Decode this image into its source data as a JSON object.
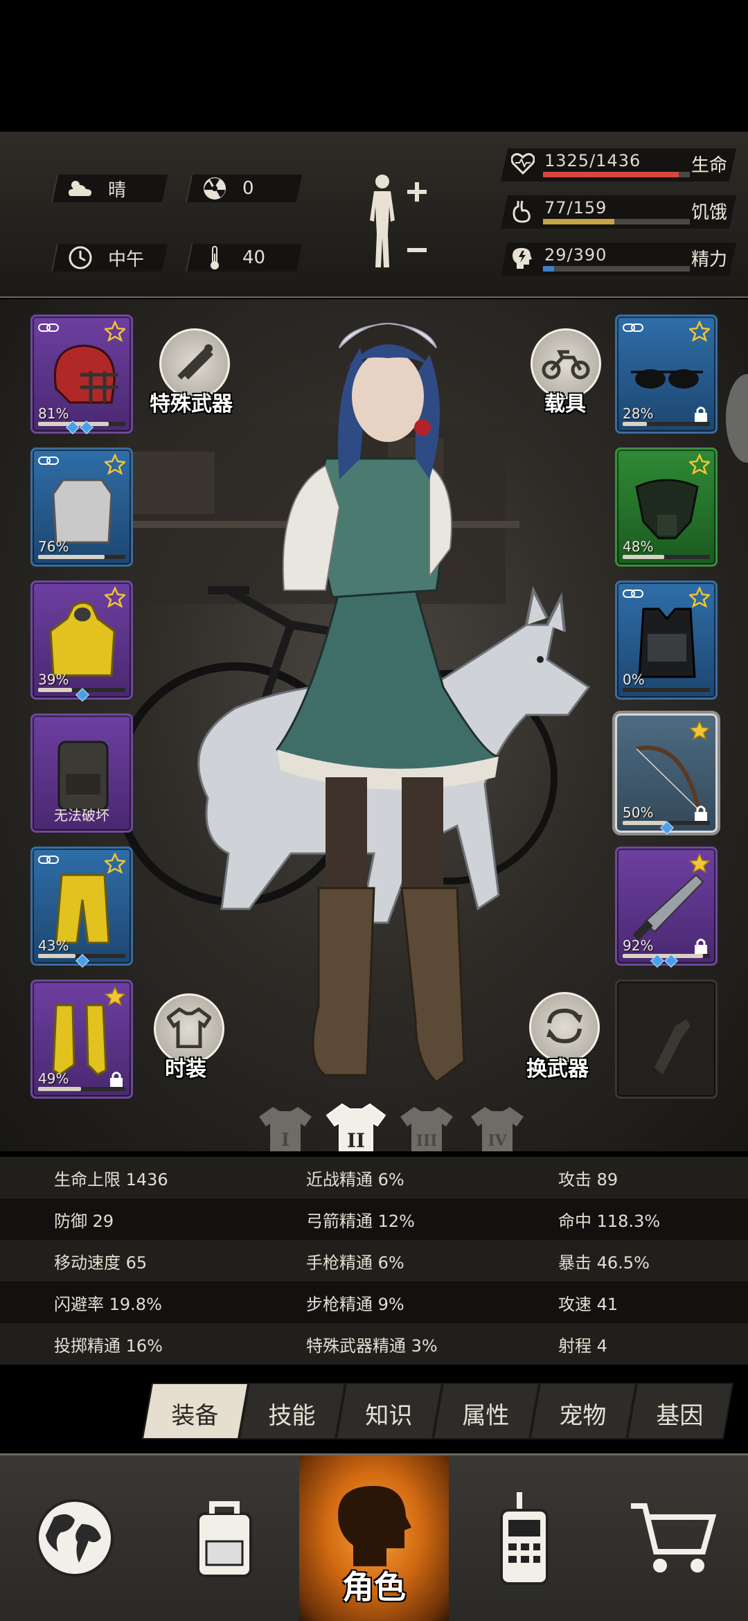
{
  "status": {
    "weather": "晴",
    "radiation": "0",
    "time_of_day": "中午",
    "temperature": "40"
  },
  "vitals": [
    {
      "label": "生命",
      "value": "1325/1436",
      "ratio": 0.923,
      "color": "#d9463f",
      "icon": "heart-icon"
    },
    {
      "label": "饥饿",
      "value": "77/159",
      "ratio": 0.484,
      "color": "#c9a443",
      "icon": "stomach-icon"
    },
    {
      "label": "精力",
      "value": "29/390",
      "ratio": 0.074,
      "color": "#3f7fc9",
      "icon": "energy-head-icon"
    }
  ],
  "left_slots": [
    {
      "name": "helmet",
      "pct": "81%",
      "rarity": "purple",
      "gems": 2
    },
    {
      "name": "shirt",
      "pct": "76%",
      "rarity": "blue",
      "gems": 0
    },
    {
      "name": "raincoat",
      "pct": "39%",
      "rarity": "purple",
      "gems": 1
    },
    {
      "name": "backpack",
      "caption": "无法破坏",
      "rarity": "purple",
      "gems": 0
    },
    {
      "name": "pants",
      "pct": "43%",
      "rarity": "blue",
      "gems": 1
    },
    {
      "name": "boots",
      "pct": "49%",
      "rarity": "purple",
      "gems": 0
    }
  ],
  "right_slots": [
    {
      "name": "sunglasses",
      "pct": "28%",
      "rarity": "blue",
      "gems": 0
    },
    {
      "name": "mask",
      "pct": "48%",
      "rarity": "green",
      "gems": 0
    },
    {
      "name": "vest",
      "pct": "0%",
      "rarity": "blue",
      "gems": 0
    },
    {
      "name": "bow",
      "pct": "50%",
      "rarity": "white",
      "gems": 1
    },
    {
      "name": "machete",
      "pct": "92%",
      "rarity": "purple",
      "gems": 2
    },
    {
      "name": "empty-slot",
      "rarity": "empty",
      "gems": 0
    }
  ],
  "buttons": {
    "special_weapon": "特殊武器",
    "vehicle": "载具",
    "fashion": "时装",
    "switch_weapon": "换武器"
  },
  "outfit_tabs": [
    "I",
    "II",
    "III",
    "IV"
  ],
  "active_outfit": 1,
  "stats": [
    [
      "生命上限 1436",
      "近战精通 6%",
      "攻击 89"
    ],
    [
      "防御 29",
      "弓箭精通 12%",
      "命中 118.3%"
    ],
    [
      "移动速度 65",
      "手枪精通 6%",
      "暴击 46.5%"
    ],
    [
      "闪避率 19.8%",
      "步枪精通 9%",
      "攻速 41"
    ],
    [
      "投掷精通 16%",
      "特殊武器精通 3%",
      "射程 4"
    ]
  ],
  "sub_tabs": [
    "装备",
    "技能",
    "知识",
    "属性",
    "宠物",
    "基因"
  ],
  "active_sub_tab": 0,
  "nav": {
    "active": "角色",
    "items": [
      "world-map-icon",
      "backpack-icon",
      "character-icon",
      "walkie-talkie-icon",
      "shopping-cart-icon"
    ]
  }
}
